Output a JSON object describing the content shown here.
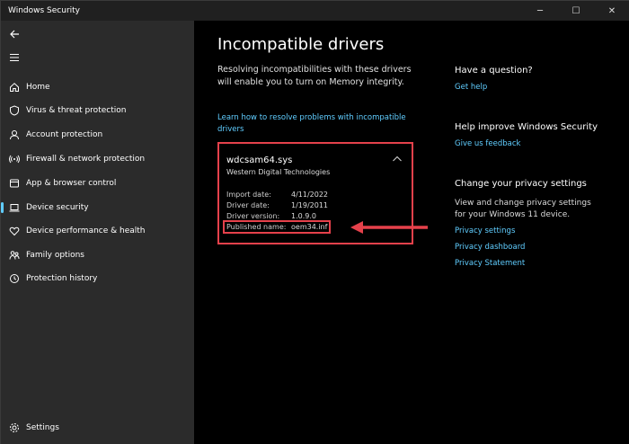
{
  "window": {
    "title": "Windows Security",
    "controls": {
      "minimize": "─",
      "maximize": "☐",
      "close": "✕"
    }
  },
  "sidebar": {
    "back_icon": "back-arrow-icon",
    "menu_icon": "hamburger-icon",
    "items": [
      {
        "label": "Home",
        "icon": "home-icon",
        "active": false
      },
      {
        "label": "Virus & threat protection",
        "icon": "shield-icon",
        "active": false
      },
      {
        "label": "Account protection",
        "icon": "person-icon",
        "active": false
      },
      {
        "label": "Firewall & network protection",
        "icon": "wifi-icon",
        "active": false
      },
      {
        "label": "App & browser control",
        "icon": "browser-icon",
        "active": false
      },
      {
        "label": "Device security",
        "icon": "laptop-icon",
        "active": true
      },
      {
        "label": "Device performance & health",
        "icon": "heart-icon",
        "active": false
      },
      {
        "label": "Family options",
        "icon": "family-icon",
        "active": false
      },
      {
        "label": "Protection history",
        "icon": "history-icon",
        "active": false
      }
    ],
    "settings": {
      "label": "Settings",
      "icon": "gear-icon"
    }
  },
  "main": {
    "title": "Incompatible drivers",
    "description": "Resolving incompatibilities with these drivers will enable you to turn on Memory integrity.",
    "learn_link": "Learn how to resolve problems with incompatible drivers",
    "driver": {
      "name": "wdcsam64.sys",
      "vendor": "Western Digital Technologies",
      "fields": [
        {
          "key": "Import date:",
          "value": "4/11/2022"
        },
        {
          "key": "Driver date:",
          "value": "1/19/2011"
        },
        {
          "key": "Driver version:",
          "value": "1.0.9.0"
        },
        {
          "key": "Published name:",
          "value": "oem34.inf"
        }
      ]
    }
  },
  "right_panel": {
    "question": {
      "title": "Have a question?",
      "link": "Get help"
    },
    "improve": {
      "title": "Help improve Windows Security",
      "link": "Give us feedback"
    },
    "privacy": {
      "title": "Change your privacy settings",
      "text": "View and change privacy settings for your Windows 11 device.",
      "links": [
        "Privacy settings",
        "Privacy dashboard",
        "Privacy Statement"
      ]
    }
  },
  "colors": {
    "accent": "#60cdff",
    "highlight": "#e5414b",
    "sidebar_bg": "#2b2b2b",
    "main_bg": "#000000"
  }
}
